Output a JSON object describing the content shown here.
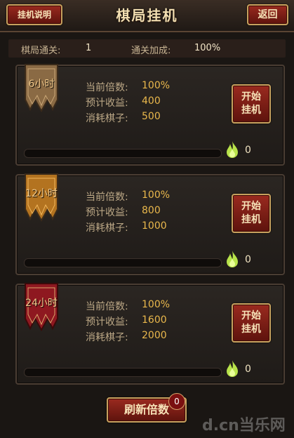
{
  "header": {
    "title": "棋局挂机",
    "help_label": "挂机说明",
    "back_label": "返回"
  },
  "summary": {
    "levels_label": "棋局通关:",
    "levels_value": "1",
    "bonus_label": "通关加成:",
    "bonus_value": "100%"
  },
  "panels": [
    {
      "duration": "6小时",
      "banner_color": "#8a6a44",
      "rows": [
        {
          "label": "当前倍数:",
          "value": "100%"
        },
        {
          "label": "预计收益:",
          "value": "400"
        },
        {
          "label": "消耗棋子:",
          "value": "500"
        }
      ],
      "start_label_1": "开始",
      "start_label_2": "挂机",
      "progress": 0,
      "flame_count": "0"
    },
    {
      "duration": "12小时",
      "banner_color": "#b37320",
      "rows": [
        {
          "label": "当前倍数:",
          "value": "100%"
        },
        {
          "label": "预计收益:",
          "value": "800"
        },
        {
          "label": "消耗棋子:",
          "value": "1000"
        }
      ],
      "start_label_1": "开始",
      "start_label_2": "挂机",
      "progress": 0,
      "flame_count": "0"
    },
    {
      "duration": "24小时",
      "banner_color": "#8e1820",
      "rows": [
        {
          "label": "当前倍数:",
          "value": "100%"
        },
        {
          "label": "预计收益:",
          "value": "1600"
        },
        {
          "label": "消耗棋子:",
          "value": "2000"
        }
      ],
      "start_label_1": "开始",
      "start_label_2": "挂机",
      "progress": 0,
      "flame_count": "0"
    }
  ],
  "refresh": {
    "label": "刷新倍数",
    "badge": "0"
  },
  "watermark": "d.cn当乐网",
  "colors": {
    "accent_gold": "#eab84c",
    "button_red": "#9a2a1f",
    "flame_green": "#b8e34a"
  }
}
